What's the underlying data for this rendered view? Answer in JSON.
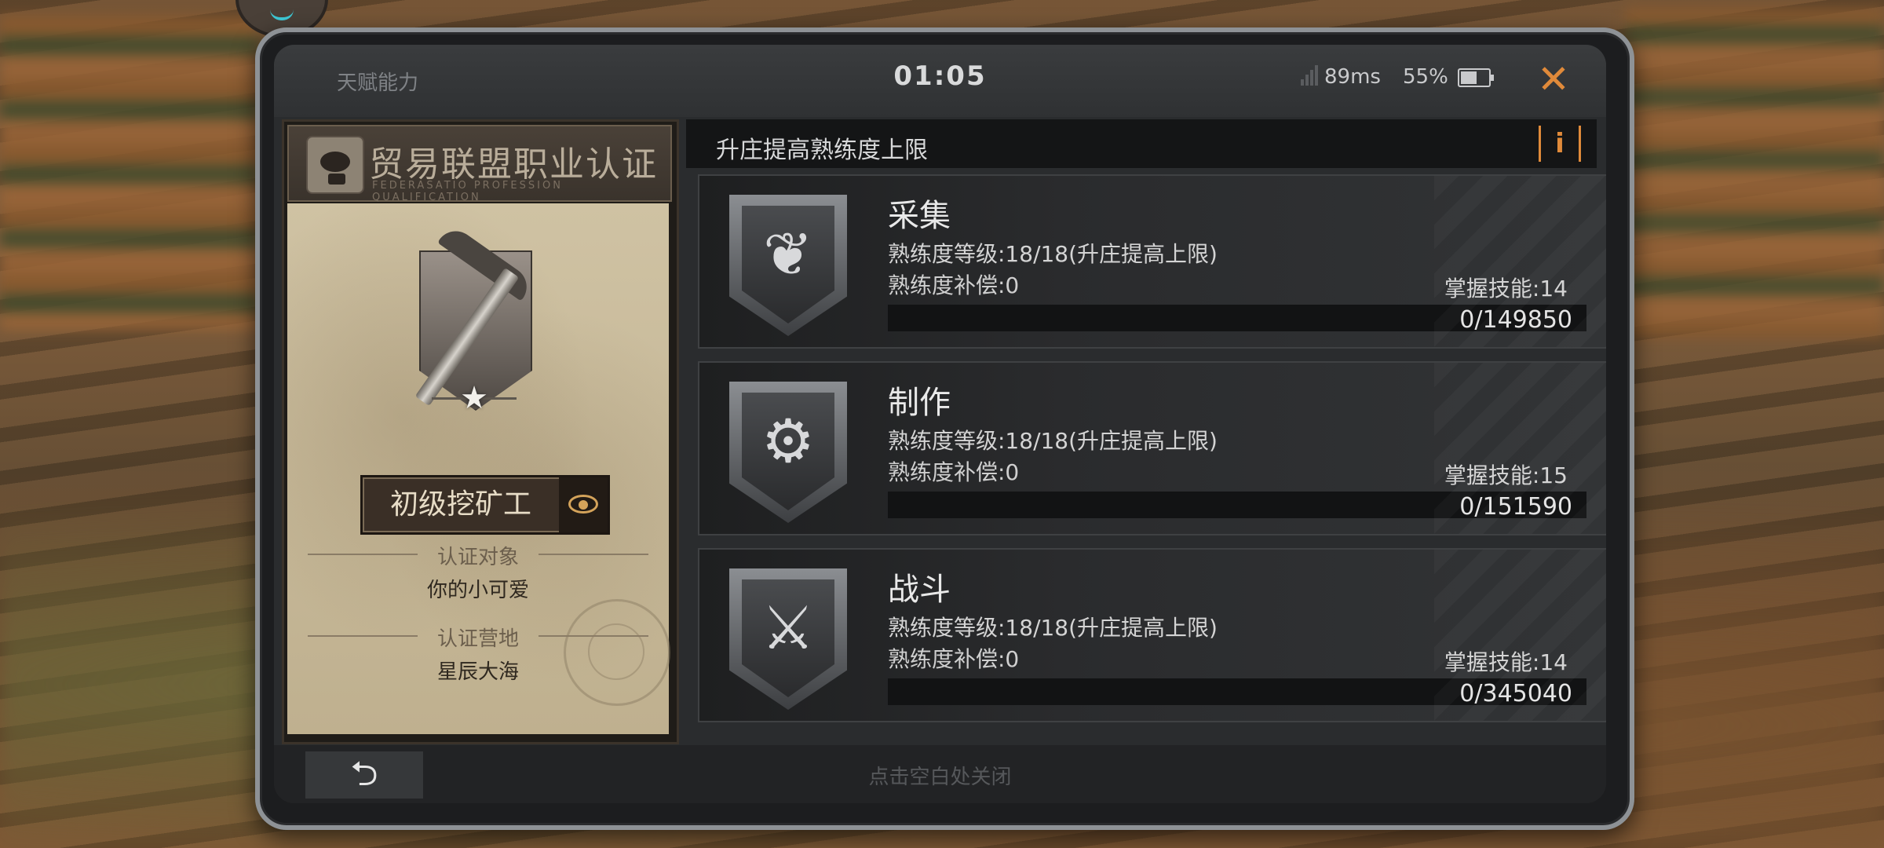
{
  "statusbar": {
    "title": "天赋能力",
    "clock": "01:05",
    "ping": "89ms",
    "battery": "55%",
    "close_icon": "close-icon"
  },
  "certificate": {
    "title": "贸易联盟职业认证",
    "subtitle": "FEDERASATIO PROFESSION QUALIFICATION",
    "rank": "初级挖矿工",
    "target_label": "认证对象",
    "target_value": "你的小可爱",
    "camp_label": "认证营地",
    "camp_value": "星辰大海"
  },
  "panel": {
    "title": "升庄提高熟练度上限",
    "info_label": "i"
  },
  "skills": [
    {
      "name": "采集",
      "level": "熟练度等级:18/18(升庄提高上限)",
      "compensation": "熟练度补偿:0",
      "mastery": "掌握技能:14",
      "exp": "0/149850",
      "progress": 0,
      "icon": "leaf-bundle-icon"
    },
    {
      "name": "制作",
      "level": "熟练度等级:18/18(升庄提高上限)",
      "compensation": "熟练度补偿:0",
      "mastery": "掌握技能:15",
      "exp": "0/151590",
      "progress": 0,
      "icon": "hammer-gear-icon"
    },
    {
      "name": "战斗",
      "level": "熟练度等级:18/18(升庄提高上限)",
      "compensation": "熟练度补偿:0",
      "mastery": "掌握技能:14",
      "exp": "0/345040",
      "progress": 0,
      "icon": "smg-icon"
    }
  ],
  "footer": {
    "close_hint": "点击空白处关闭",
    "back_icon": "back-arrow-icon"
  },
  "colors": {
    "accent": "#e08a3a",
    "panel_bg": "#2a2c2e"
  }
}
